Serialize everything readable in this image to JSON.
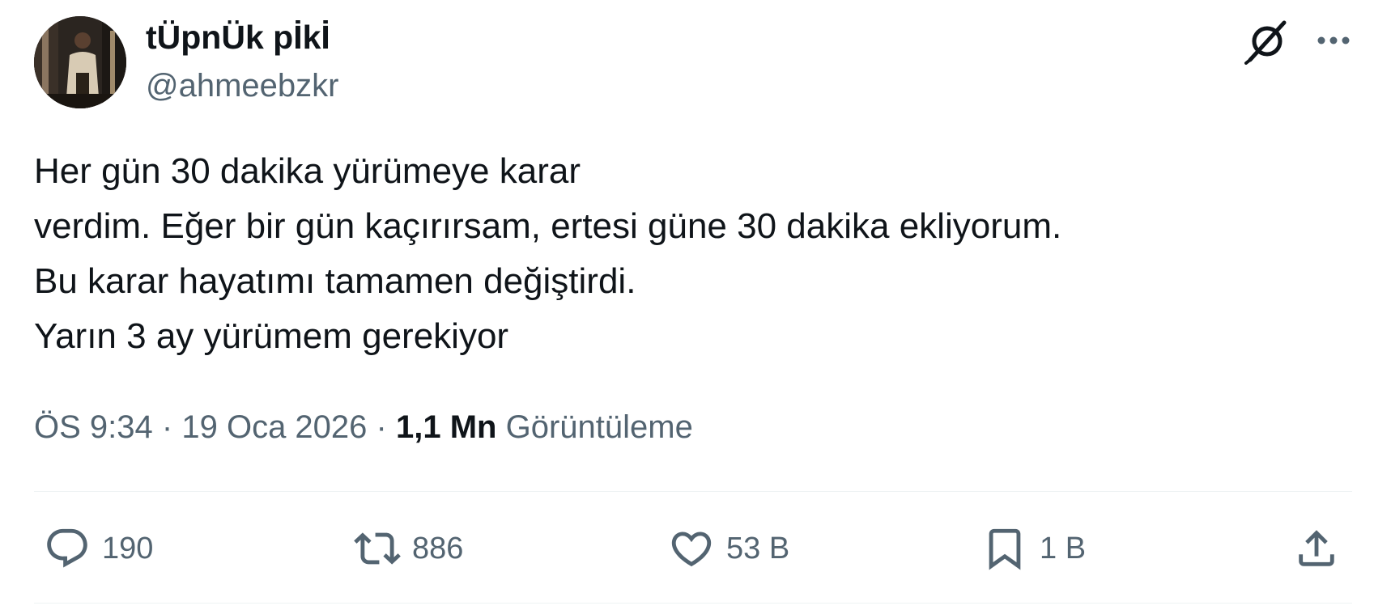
{
  "author": {
    "display_name": "tÜpnÜk pİkİ",
    "handle": "@ahmeebzkr"
  },
  "header_icons": {
    "grok": "grok-icon",
    "more": "more-icon"
  },
  "tweet": {
    "text": "Her gün 30 dakika yürümeye karar\nverdim. Eğer bir gün kaçırırsam, ertesi güne 30 dakika ekliyorum.\nBu karar hayatımı tamamen değiştirdi.\nYarın 3 ay yürümem gerekiyor"
  },
  "meta": {
    "time": "ÖS 9:34",
    "separator": "·",
    "date": "19 Oca 2026",
    "views_count": "1,1 Mn",
    "views_label": "Görüntüleme"
  },
  "actions": {
    "reply": {
      "icon": "reply-icon",
      "count": "190"
    },
    "repost": {
      "icon": "repost-icon",
      "count": "886"
    },
    "like": {
      "icon": "heart-icon",
      "count": "53 B"
    },
    "bookmark": {
      "icon": "bookmark-icon",
      "count": "1 B"
    },
    "share": {
      "icon": "share-icon"
    }
  },
  "colors": {
    "primary_text": "#0f1419",
    "secondary_text": "#536471",
    "divider": "#eff3f4"
  }
}
